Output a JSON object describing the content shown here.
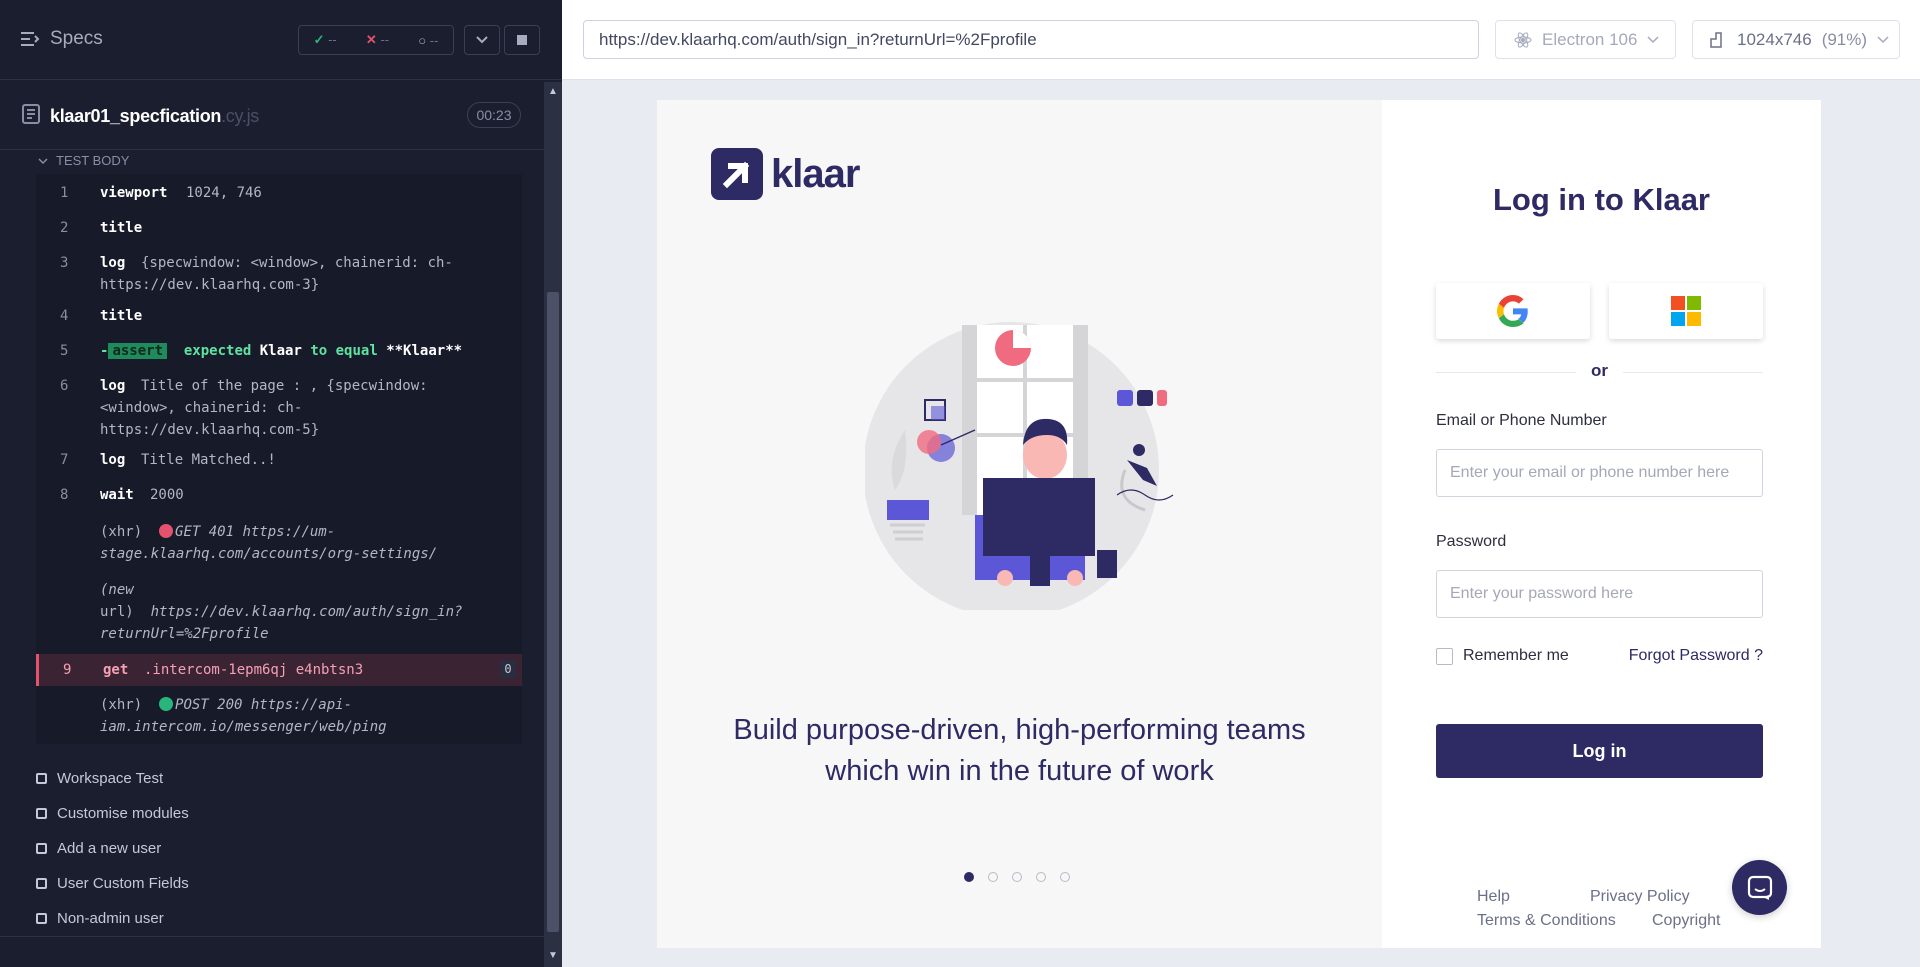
{
  "runner": {
    "specs_label": "Specs",
    "stats": {
      "passed": "--",
      "failed": "--",
      "pending": "--"
    },
    "spec_name": "klaar01_specfication",
    "spec_ext": ".cy.js",
    "duration": "00:23",
    "test_body_label": "TEST BODY",
    "commands": [
      {
        "num": "1",
        "name": "viewport",
        "msg": "1024, 746"
      },
      {
        "num": "2",
        "name": "title",
        "msg": ""
      },
      {
        "num": "3",
        "name": "log",
        "msg_line1": "{specwindow: <window>, chainerid: ch-",
        "msg_line2": "https://dev.klaarhq.com-3}"
      },
      {
        "num": "4",
        "name": "title",
        "msg": ""
      },
      {
        "num": "5",
        "name": "-assert",
        "badge": "assert",
        "msg": "expected Klaar to equal **Klaar**",
        "prefix": "-",
        "p1": "expected ",
        "p2": "Klaar",
        "p3": " to equal ",
        "p4": "**Klaar**"
      },
      {
        "num": "6",
        "name": "log",
        "msg_line1": "Title of the page : , {specwindow:",
        "msg_line2": "<window>, chainerid: ch-",
        "msg_line3": "https://dev.klaarhq.com-5}"
      },
      {
        "num": "7",
        "name": "log",
        "msg": "Title Matched..!"
      },
      {
        "num": "8",
        "name": "wait",
        "msg": "2000"
      },
      {
        "label": "(xhr)",
        "msg_line1": "GET 401 https://um-",
        "msg_line2": "stage.klaarhq.com/accounts/org-settings/"
      },
      {
        "label_line1": "(new",
        "label_line2": "url)",
        "msg_line1": "https://dev.klaarhq.com/auth/sign_in?",
        "msg_line2": "returnUrl=%2Fprofile"
      },
      {
        "num": "9",
        "name": "get",
        "msg": ".intercom-1epm6qj e4nbtsn3",
        "count": "0"
      },
      {
        "label": "(xhr)",
        "msg_line1": "POST 200 https://api-",
        "msg_line2": "iam.intercom.io/messenger/web/ping"
      }
    ],
    "tests": [
      "Workspace Test",
      "Customise modules",
      "Add a new user",
      "User Custom Fields",
      "Non-admin user"
    ]
  },
  "aut": {
    "url": "https://dev.klaarhq.com/auth/sign_in?returnUrl=%2Fprofile",
    "browser": "Electron 106",
    "viewport": "1024x746",
    "zoom": "(91%)"
  },
  "page": {
    "logo_text": "klaar",
    "tagline_line1": "Build purpose-driven, high-performing teams",
    "tagline_line2": "which win in the future of work",
    "carousel_active": 1,
    "login_title": "Log in to Klaar",
    "or_text": "or",
    "email_label": "Email or Phone Number",
    "email_placeholder": "Enter your email or phone number here",
    "password_label": "Password",
    "password_placeholder": "Enter your password here",
    "remember_label": "Remember me",
    "forgot_label": "Forgot Password ?",
    "login_button": "Log in",
    "footer": {
      "help": "Help",
      "privacy": "Privacy Policy",
      "terms": "Terms & Conditions",
      "copyright": "Copyright"
    }
  },
  "colors": {
    "brand": "#2d2a64",
    "pass": "#28b67c",
    "fail": "#e4526d"
  }
}
